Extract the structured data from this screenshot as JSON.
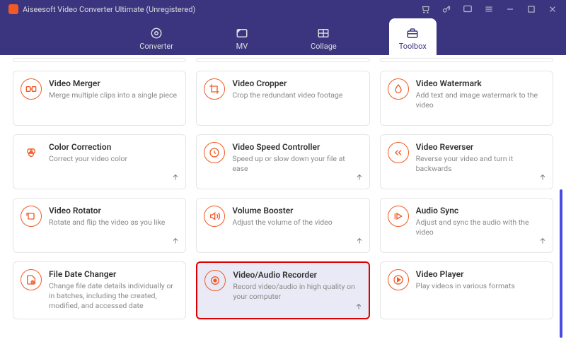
{
  "window": {
    "title": "Aiseesoft Video Converter Ultimate (Unregistered)"
  },
  "tabs": [
    {
      "label": "Converter"
    },
    {
      "label": "MV"
    },
    {
      "label": "Collage"
    },
    {
      "label": "Toolbox"
    }
  ],
  "active_tab": 3,
  "tools": [
    {
      "title": "Video Merger",
      "desc": "Merge multiple clips into a single piece",
      "icon": "merger",
      "pinned": false,
      "highlight": false
    },
    {
      "title": "Video Cropper",
      "desc": "Crop the redundant video footage",
      "icon": "crop",
      "pinned": false,
      "highlight": false
    },
    {
      "title": "Video Watermark",
      "desc": "Add text and image watermark to the video",
      "icon": "water",
      "pinned": false,
      "highlight": false
    },
    {
      "title": "Color Correction",
      "desc": "Correct your video color",
      "icon": "color",
      "pinned": true,
      "highlight": false
    },
    {
      "title": "Video Speed Controller",
      "desc": "Speed up or slow down your file at ease",
      "icon": "speed",
      "pinned": true,
      "highlight": false
    },
    {
      "title": "Video Reverser",
      "desc": "Reverse your video and turn it backwards",
      "icon": "reverse",
      "pinned": true,
      "highlight": false
    },
    {
      "title": "Video Rotator",
      "desc": "Rotate and flip the video as you like",
      "icon": "rotate",
      "pinned": true,
      "highlight": false
    },
    {
      "title": "Volume Booster",
      "desc": "Adjust the volume of the video",
      "icon": "volume",
      "pinned": true,
      "highlight": false
    },
    {
      "title": "Audio Sync",
      "desc": "Adjust and sync the audio with the video",
      "icon": "sync",
      "pinned": true,
      "highlight": false
    },
    {
      "title": "File Date Changer",
      "desc": "Change file date details individually or in batches, including the created, modified, and accessed date",
      "icon": "date",
      "pinned": false,
      "highlight": false
    },
    {
      "title": "Video/Audio Recorder",
      "desc": "Record video/audio in high quality on your computer",
      "icon": "record",
      "pinned": true,
      "highlight": true
    },
    {
      "title": "Video Player",
      "desc": "Play videos in various formats",
      "icon": "play",
      "pinned": false,
      "highlight": false
    }
  ]
}
